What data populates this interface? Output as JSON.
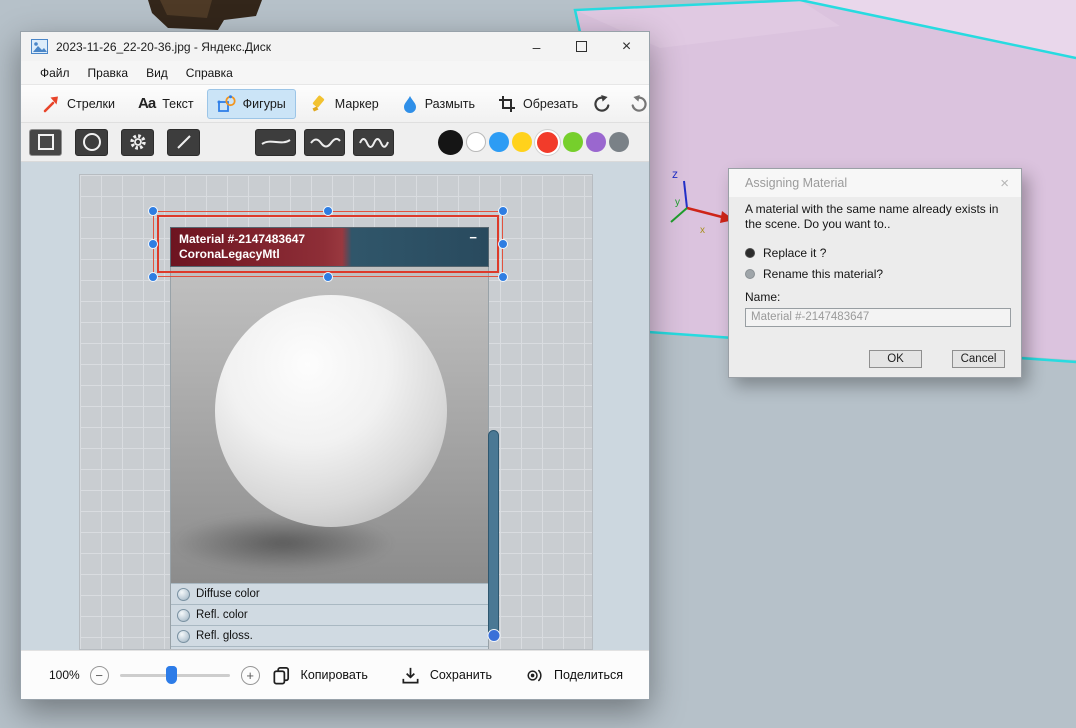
{
  "window": {
    "title": "2023-11-26_22-20-36.jpg - Яндекс.Диск",
    "minimize_icon": "–",
    "close_icon": "×"
  },
  "menu": {
    "items": [
      {
        "label": "Файл"
      },
      {
        "label": "Правка"
      },
      {
        "label": "Вид"
      },
      {
        "label": "Справка"
      }
    ]
  },
  "toolbar": {
    "arrows_label": "Стрелки",
    "text_label": "Текст",
    "text_icon": "Aa",
    "shapes_label": "Фигуры",
    "marker_label": "Маркер",
    "blur_label": "Размыть",
    "crop_label": "Обрезать"
  },
  "shape_toolbar": {
    "colors": [
      {
        "name": "black",
        "hex": "#151515",
        "selected": false
      },
      {
        "name": "white",
        "hex": "#ffffff",
        "selected": false
      },
      {
        "name": "blue",
        "hex": "#2d9cf4",
        "selected": false
      },
      {
        "name": "yellow",
        "hex": "#ffd21c",
        "selected": false
      },
      {
        "name": "red",
        "hex": "#f23b2a",
        "selected": true
      },
      {
        "name": "green",
        "hex": "#76cf2c",
        "selected": false
      },
      {
        "name": "purple",
        "hex": "#9a67cf",
        "selected": false
      },
      {
        "name": "gray",
        "hex": "#7a8187",
        "selected": false
      }
    ]
  },
  "canvas": {
    "material_editor": {
      "title_line1": "Material #-2147483647",
      "title_line2": "CoronaLegacyMtl",
      "minimize_icon": "−",
      "params": [
        {
          "label": "Diffuse color"
        },
        {
          "label": "Refl. color"
        },
        {
          "label": "Refl. gloss."
        }
      ]
    },
    "annotation_color": "#dd3a2a"
  },
  "scene": {
    "axis_z": "z",
    "axis_x": "x",
    "axis_y": "y"
  },
  "bottom_bar": {
    "zoom_value": "100%",
    "minus_icon": "−",
    "plus_icon": "+",
    "copy_label": "Копировать",
    "save_label": "Сохранить",
    "share_label": "Поделиться"
  },
  "dialog": {
    "title": "Assigning Material",
    "close_icon": "×",
    "message": "A  material with the same name already exists in the scene. Do you want to..",
    "radio_replace": "Replace it ?",
    "radio_rename": "Rename this material?",
    "name_label": "Name:",
    "name_value": "Material #-2147483647",
    "ok_label": "OK",
    "cancel_label": "Cancel"
  }
}
